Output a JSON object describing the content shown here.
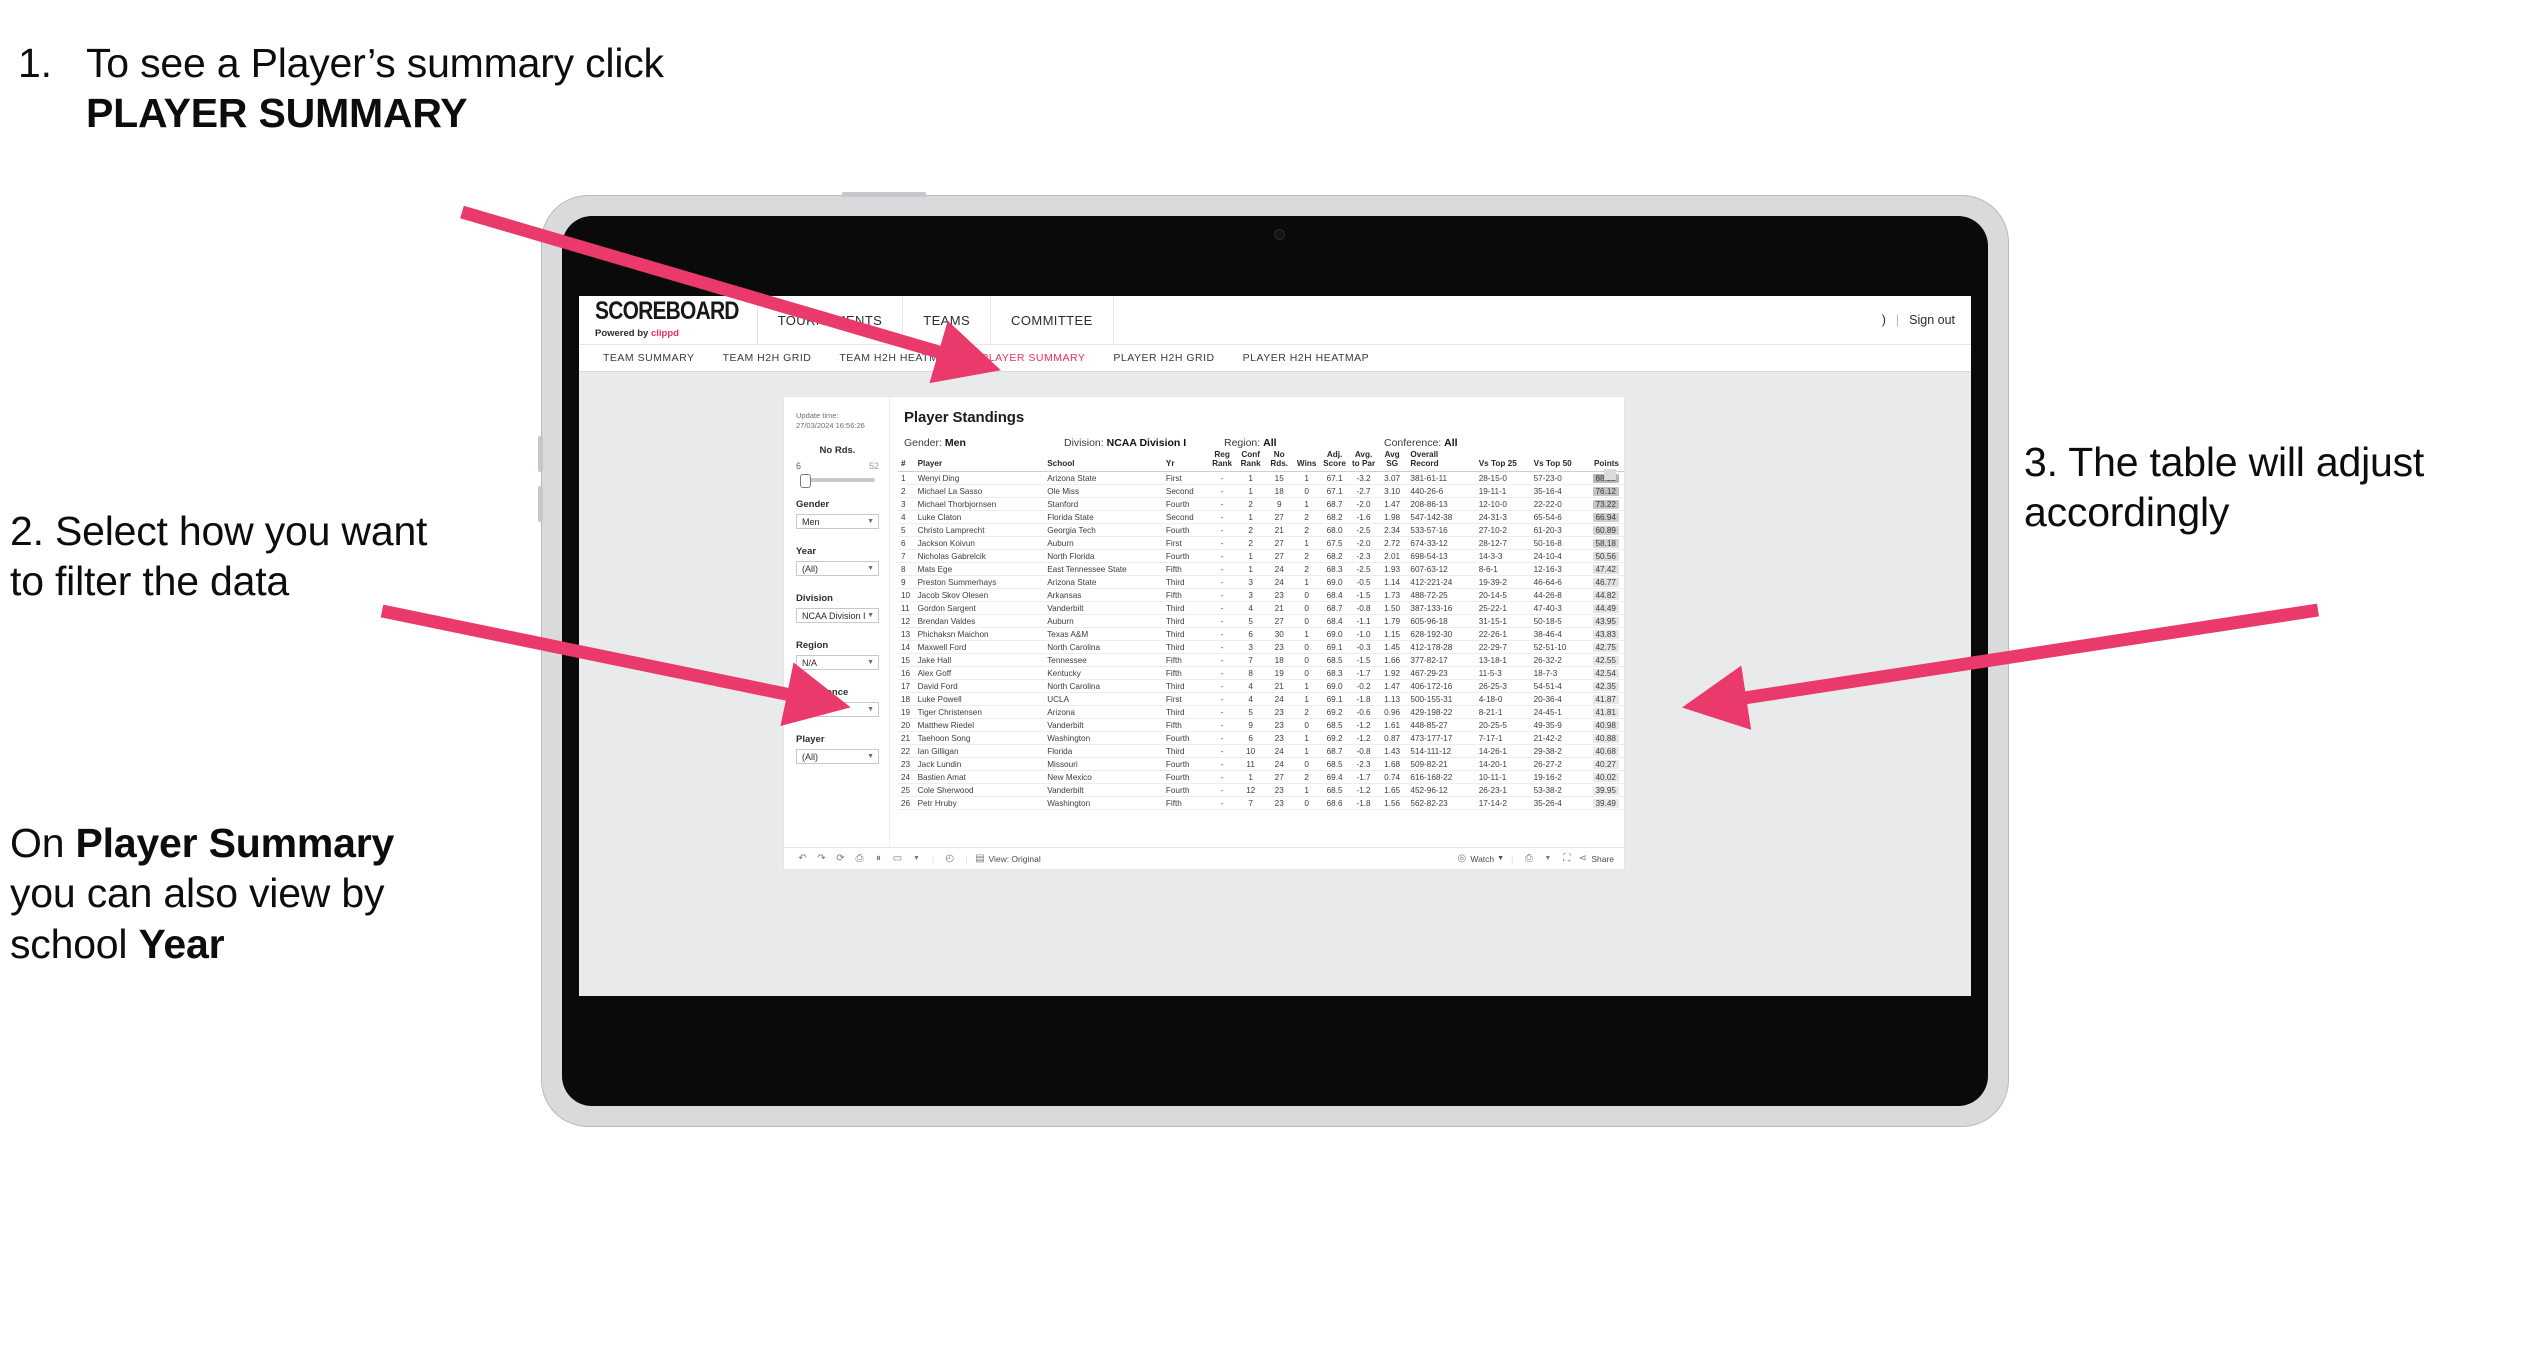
{
  "annotations": {
    "step1": {
      "number": "1.",
      "text_before": "To see a Player’s summary click ",
      "bold": "PLAYER SUMMARY"
    },
    "step2": {
      "text": "2. Select how you want to filter the data"
    },
    "step2b": {
      "prefix": "On ",
      "bold1": "Player Summary",
      "middle": " you can also view by school ",
      "bold2": "Year"
    },
    "step3": {
      "text": "3. The table will adjust accordingly"
    }
  },
  "colors": {
    "accent_pink": "#e6305f",
    "arrow_pink": "#ea3a6b",
    "tablet_body": "#d9dadc",
    "screen_bg": "#e9eaec"
  },
  "app": {
    "brand": {
      "wordmark": "SCOREBOARD",
      "powered_prefix": "Powered by ",
      "powered_name": "clippd"
    },
    "top_nav": [
      "TOURNAMENTS",
      "TEAMS",
      "COMMITTEE"
    ],
    "header_right": {
      "truncated": ")",
      "divider": "|",
      "sign_out": "Sign out"
    },
    "sub_nav": [
      {
        "label": "TEAM SUMMARY",
        "active": false
      },
      {
        "label": "TEAM H2H GRID",
        "active": false
      },
      {
        "label": "TEAM H2H HEATMAP",
        "active": false
      },
      {
        "label": "PLAYER SUMMARY",
        "active": true
      },
      {
        "label": "PLAYER H2H GRID",
        "active": false
      },
      {
        "label": "PLAYER H2H HEATMAP",
        "active": false
      }
    ]
  },
  "viz": {
    "update_time_label": "Update time:",
    "update_time_value": "27/03/2024 16:56:26",
    "title": "Player Standings",
    "filter_summary": [
      {
        "label": "Gender:",
        "value": "Men"
      },
      {
        "label": "Division:",
        "value": "NCAA Division I"
      },
      {
        "label": "Region:",
        "value": "All"
      },
      {
        "label": "Conference:",
        "value": "All"
      }
    ],
    "filters": {
      "slider": {
        "title": "No Rds.",
        "min": "6",
        "max": "52"
      },
      "selects": [
        {
          "label": "Gender",
          "value": "Men"
        },
        {
          "label": "Year",
          "value": "(All)"
        },
        {
          "label": "Division",
          "value": "NCAA Division I"
        },
        {
          "label": "Region",
          "value": "N/A"
        },
        {
          "label": "Conference",
          "value": "(All)"
        },
        {
          "label": "Player",
          "value": "(All)"
        }
      ]
    },
    "toolbar": {
      "view_label": "View: Original",
      "watch_label": "Watch",
      "share_label": "Share"
    }
  },
  "chart_data": {
    "type": "table",
    "title": "Player Standings",
    "columns": [
      "#",
      "Player",
      "School",
      "Yr",
      "Reg\nRank",
      "Conf\nRank",
      "No\nRds.",
      "Wins",
      "Adj.\nScore",
      "Avg.\nto Par",
      "Avg\nSG",
      "Overall\nRecord",
      "Vs Top 25",
      "Vs Top 50",
      "Points"
    ],
    "rows": [
      [
        "1",
        "Wenyi Ding",
        "Arizona State",
        "First",
        "-",
        "1",
        "15",
        "1",
        "67.1",
        "-3.2",
        "3.07",
        "381-61-11",
        "28-15-0",
        "57-23-0",
        "88.22"
      ],
      [
        "2",
        "Michael La Sasso",
        "Ole Miss",
        "Second",
        "-",
        "1",
        "18",
        "0",
        "67.1",
        "-2.7",
        "3.10",
        "440-26-6",
        "19-11-1",
        "35-16-4",
        "76.12"
      ],
      [
        "3",
        "Michael Thorbjornsen",
        "Stanford",
        "Fourth",
        "-",
        "2",
        "9",
        "1",
        "68.7",
        "-2.0",
        "1.47",
        "208-86-13",
        "12-10-0",
        "22-22-0",
        "73.22"
      ],
      [
        "4",
        "Luke Claton",
        "Florida State",
        "Second",
        "-",
        "1",
        "27",
        "2",
        "68.2",
        "-1.6",
        "1.98",
        "547-142-38",
        "24-31-3",
        "65-54-6",
        "66.94"
      ],
      [
        "5",
        "Christo Lamprecht",
        "Georgia Tech",
        "Fourth",
        "-",
        "2",
        "21",
        "2",
        "68.0",
        "-2.5",
        "2.34",
        "533-57-16",
        "27-10-2",
        "61-20-3",
        "60.89"
      ],
      [
        "6",
        "Jackson Koivun",
        "Auburn",
        "First",
        "-",
        "2",
        "27",
        "1",
        "67.5",
        "-2.0",
        "2.72",
        "674-33-12",
        "28-12-7",
        "50-16-8",
        "58.18"
      ],
      [
        "7",
        "Nicholas Gabrelcik",
        "North Florida",
        "Fourth",
        "-",
        "1",
        "27",
        "2",
        "68.2",
        "-2.3",
        "2.01",
        "698-54-13",
        "14-3-3",
        "24-10-4",
        "50.56"
      ],
      [
        "8",
        "Mats Ege",
        "East Tennessee State",
        "Fifth",
        "-",
        "1",
        "24",
        "2",
        "68.3",
        "-2.5",
        "1.93",
        "607-63-12",
        "8-6-1",
        "12-16-3",
        "47.42"
      ],
      [
        "9",
        "Preston Summerhays",
        "Arizona State",
        "Third",
        "-",
        "3",
        "24",
        "1",
        "69.0",
        "-0.5",
        "1.14",
        "412-221-24",
        "19-39-2",
        "46-64-6",
        "46.77"
      ],
      [
        "10",
        "Jacob Skov Olesen",
        "Arkansas",
        "Fifth",
        "-",
        "3",
        "23",
        "0",
        "68.4",
        "-1.5",
        "1.73",
        "488-72-25",
        "20-14-5",
        "44-26-8",
        "44.82"
      ],
      [
        "11",
        "Gordon Sargent",
        "Vanderbilt",
        "Third",
        "-",
        "4",
        "21",
        "0",
        "68.7",
        "-0.8",
        "1.50",
        "387-133-16",
        "25-22-1",
        "47-40-3",
        "44.49"
      ],
      [
        "12",
        "Brendan Valdes",
        "Auburn",
        "Third",
        "-",
        "5",
        "27",
        "0",
        "68.4",
        "-1.1",
        "1.79",
        "605-96-18",
        "31-15-1",
        "50-18-5",
        "43.95"
      ],
      [
        "13",
        "Phichaksn Maichon",
        "Texas A&M",
        "Third",
        "-",
        "6",
        "30",
        "1",
        "69.0",
        "-1.0",
        "1.15",
        "628-192-30",
        "22-26-1",
        "38-46-4",
        "43.83"
      ],
      [
        "14",
        "Maxwell Ford",
        "North Carolina",
        "Third",
        "-",
        "3",
        "23",
        "0",
        "69.1",
        "-0.3",
        "1.45",
        "412-178-28",
        "22-29-7",
        "52-51-10",
        "42.75"
      ],
      [
        "15",
        "Jake Hall",
        "Tennessee",
        "Fifth",
        "-",
        "7",
        "18",
        "0",
        "68.5",
        "-1.5",
        "1.66",
        "377-82-17",
        "13-18-1",
        "26-32-2",
        "42.55"
      ],
      [
        "16",
        "Alex Goff",
        "Kentucky",
        "Fifth",
        "-",
        "8",
        "19",
        "0",
        "68.3",
        "-1.7",
        "1.92",
        "467-29-23",
        "11-5-3",
        "18-7-3",
        "42.54"
      ],
      [
        "17",
        "David Ford",
        "North Carolina",
        "Third",
        "-",
        "4",
        "21",
        "1",
        "69.0",
        "-0.2",
        "1.47",
        "406-172-16",
        "26-25-3",
        "54-51-4",
        "42.35"
      ],
      [
        "18",
        "Luke Powell",
        "UCLA",
        "First",
        "-",
        "4",
        "24",
        "1",
        "69.1",
        "-1.8",
        "1.13",
        "500-155-31",
        "4-18-0",
        "20-36-4",
        "41.87"
      ],
      [
        "19",
        "Tiger Christensen",
        "Arizona",
        "Third",
        "-",
        "5",
        "23",
        "2",
        "69.2",
        "-0.6",
        "0.96",
        "429-198-22",
        "8-21-1",
        "24-45-1",
        "41.81"
      ],
      [
        "20",
        "Matthew Riedel",
        "Vanderbilt",
        "Fifth",
        "-",
        "9",
        "23",
        "0",
        "68.5",
        "-1.2",
        "1.61",
        "448-85-27",
        "20-25-5",
        "49-35-9",
        "40.98"
      ],
      [
        "21",
        "Taehoon Song",
        "Washington",
        "Fourth",
        "-",
        "6",
        "23",
        "1",
        "69.2",
        "-1.2",
        "0.87",
        "473-177-17",
        "7-17-1",
        "21-42-2",
        "40.88"
      ],
      [
        "22",
        "Ian Gilligan",
        "Florida",
        "Third",
        "-",
        "10",
        "24",
        "1",
        "68.7",
        "-0.8",
        "1.43",
        "514-111-12",
        "14-26-1",
        "29-38-2",
        "40.68"
      ],
      [
        "23",
        "Jack Lundin",
        "Missouri",
        "Fourth",
        "-",
        "11",
        "24",
        "0",
        "68.5",
        "-2.3",
        "1.68",
        "509-82-21",
        "14-20-1",
        "26-27-2",
        "40.27"
      ],
      [
        "24",
        "Bastien Amat",
        "New Mexico",
        "Fourth",
        "-",
        "1",
        "27",
        "2",
        "69.4",
        "-1.7",
        "0.74",
        "616-168-22",
        "10-11-1",
        "19-16-2",
        "40.02"
      ],
      [
        "25",
        "Cole Sherwood",
        "Vanderbilt",
        "Fourth",
        "-",
        "12",
        "23",
        "1",
        "68.5",
        "-1.2",
        "1.65",
        "452-96-12",
        "26-23-1",
        "53-38-2",
        "39.95"
      ],
      [
        "26",
        "Petr Hruby",
        "Washington",
        "Fifth",
        "-",
        "7",
        "23",
        "0",
        "68.6",
        "-1.8",
        "1.56",
        "562-82-23",
        "17-14-2",
        "35-26-4",
        "39.49"
      ]
    ],
    "points_min": 39.49,
    "points_max": 88.22
  }
}
